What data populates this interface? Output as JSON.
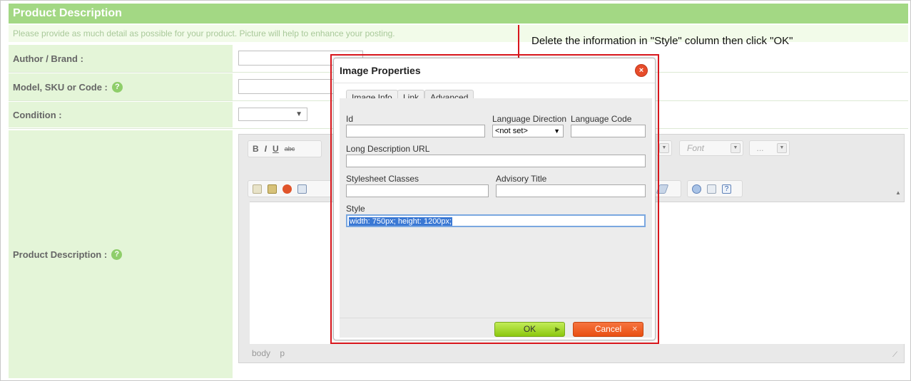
{
  "section": {
    "title": "Product Description",
    "hint": "Please provide as much detail as possible for your product. Picture will help to enhance your posting."
  },
  "form": {
    "author_label": "Author / Brand :",
    "model_label": "Model, SKU or Code :",
    "condition_label": "Condition :",
    "description_label": "Product Description :",
    "help_glyph": "?"
  },
  "editor": {
    "font_combo": "Font",
    "size_combo": "...",
    "status_path": [
      "body",
      "p"
    ],
    "bold": "B",
    "italic": "I",
    "underline": "U",
    "strike": "abc"
  },
  "annotation": {
    "text": "Delete the information in \"Style\" column then click \"OK\"",
    "color": "#d8161c"
  },
  "dialog": {
    "title": "Image Properties",
    "tabs": [
      "Image Info",
      "Link",
      "Advanced"
    ],
    "active_tab": "Advanced",
    "id_label": "Id",
    "lang_dir_label": "Language Direction",
    "lang_dir_value": "<not set>",
    "lang_code_label": "Language Code",
    "long_desc_label": "Long Description URL",
    "stylesheet_label": "Stylesheet Classes",
    "advisory_label": "Advisory Title",
    "style_label": "Style",
    "style_value": "width: 750px; height: 1200px;",
    "ok_label": "OK",
    "cancel_label": "Cancel"
  },
  "colors": {
    "header_green": "#a3d884",
    "label_bg": "#e4f5d8",
    "ok_green": "#8cc70f",
    "cancel_orange": "#e94f12"
  }
}
